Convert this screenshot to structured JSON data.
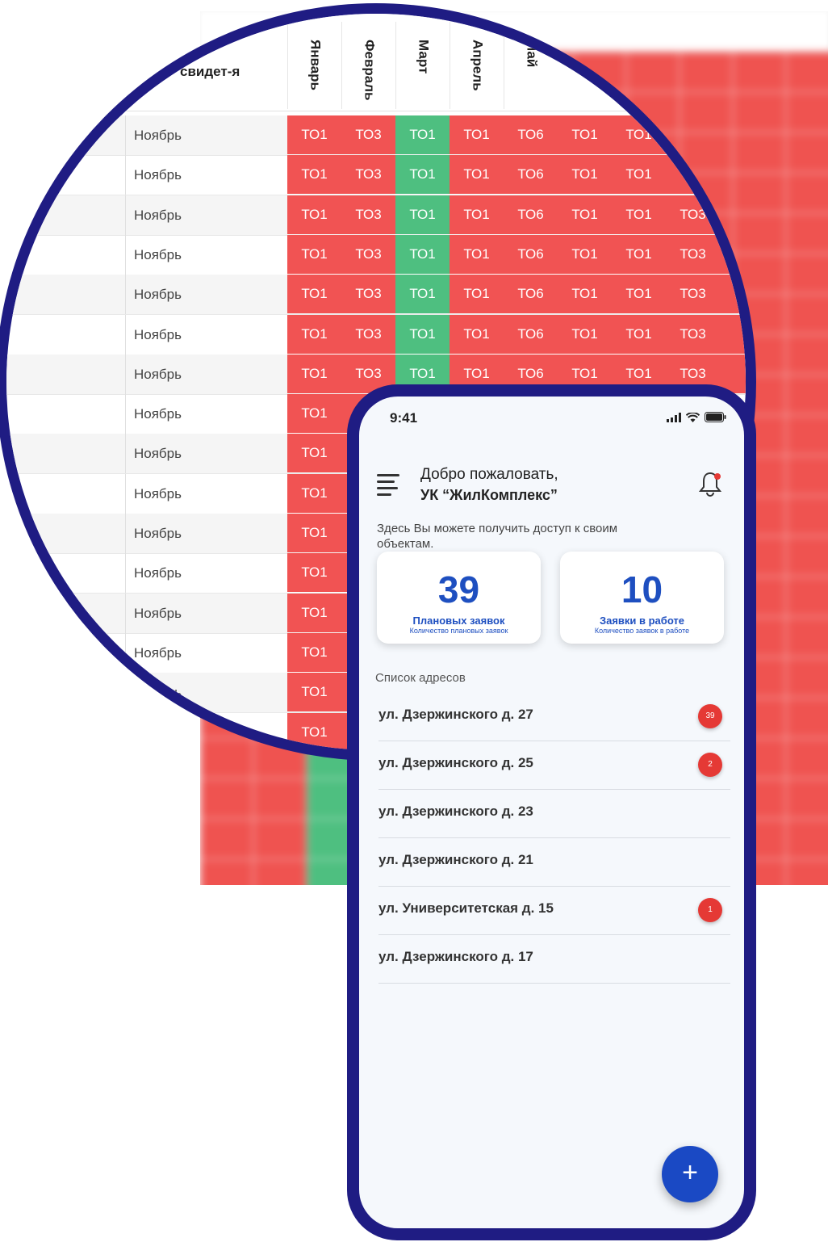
{
  "table": {
    "header_cert": "свидет-я",
    "months": [
      "Январь",
      "Февраль",
      "Март",
      "Апрель",
      "Май"
    ],
    "row_month": "Ноябрь",
    "rows": [
      [
        "ТО1",
        "ТО3",
        "ТО1",
        "ТО1",
        "ТО6",
        "ТО1",
        "ТО1"
      ],
      [
        "ТО1",
        "ТО3",
        "ТО1",
        "ТО1",
        "ТО6",
        "ТО1",
        "ТО1"
      ],
      [
        "ТО1",
        "ТО3",
        "ТО1",
        "ТО1",
        "ТО6",
        "ТО1",
        "ТО1",
        "ТО3"
      ],
      [
        "ТО1",
        "ТО3",
        "ТО1",
        "ТО1",
        "ТО6",
        "ТО1",
        "ТО1",
        "ТО3"
      ],
      [
        "ТО1",
        "ТО3",
        "ТО1",
        "ТО1",
        "ТО6",
        "ТО1",
        "ТО1",
        "ТО3"
      ],
      [
        "ТО1",
        "ТО3",
        "ТО1",
        "ТО1",
        "ТО6",
        "ТО1",
        "ТО1",
        "ТО3"
      ],
      [
        "ТО1",
        "ТО3",
        "ТО1",
        "ТО1",
        "ТО6",
        "ТО1",
        "ТО1",
        "ТО3"
      ],
      [
        "ТО1"
      ],
      [
        "ТО1"
      ],
      [
        "ТО1"
      ],
      [
        "ТО1"
      ],
      [
        "ТО1"
      ],
      [
        "ТО1"
      ],
      [
        "ТО1"
      ],
      [
        "ТО1"
      ],
      [
        "ТО1"
      ]
    ],
    "green_column": 2,
    "colors": {
      "red": "#f15353",
      "green": "#4ebf80"
    }
  },
  "phone": {
    "status": {
      "time": "9:41"
    },
    "header": {
      "greeting": "Добро пожаловать,",
      "company": "УК “ЖилКомплекс”"
    },
    "intro": "Здесь Вы можете получить доступ к своим объектам.",
    "cards": [
      {
        "number": "39",
        "label": "Плановых заявок",
        "sub": "Количество плановых заявок"
      },
      {
        "number": "10",
        "label": "Заявки в работе",
        "sub": "Количество заявок в работе"
      }
    ],
    "list_title": "Список адресов",
    "addresses": [
      {
        "text": "ул. Дзержинского д. 27",
        "badge": "39"
      },
      {
        "text": "ул. Дзержинского д.  25",
        "badge": "2"
      },
      {
        "text": "ул. Дзержинского д. 23",
        "badge": ""
      },
      {
        "text": "ул. Дзержинского д. 21",
        "badge": ""
      },
      {
        "text": "ул. Университетская д. 15",
        "badge": "1"
      },
      {
        "text": "ул. Дзержинского д. 17",
        "badge": ""
      }
    ],
    "fab": "+",
    "accent": "#1a49c4",
    "frame_color": "#1f1c83",
    "badge_color": "#e53935"
  }
}
